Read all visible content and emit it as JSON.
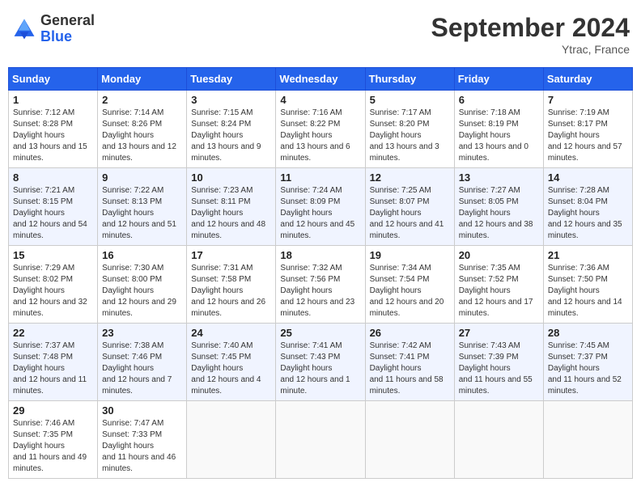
{
  "header": {
    "logo_general": "General",
    "logo_blue": "Blue",
    "month_title": "September 2024",
    "location": "Ytrac, France"
  },
  "weekdays": [
    "Sunday",
    "Monday",
    "Tuesday",
    "Wednesday",
    "Thursday",
    "Friday",
    "Saturday"
  ],
  "weeks": [
    [
      {
        "day": "1",
        "sunrise": "7:12 AM",
        "sunset": "8:28 PM",
        "daylight": "13 hours and 15 minutes."
      },
      {
        "day": "2",
        "sunrise": "7:14 AM",
        "sunset": "8:26 PM",
        "daylight": "13 hours and 12 minutes."
      },
      {
        "day": "3",
        "sunrise": "7:15 AM",
        "sunset": "8:24 PM",
        "daylight": "13 hours and 9 minutes."
      },
      {
        "day": "4",
        "sunrise": "7:16 AM",
        "sunset": "8:22 PM",
        "daylight": "13 hours and 6 minutes."
      },
      {
        "day": "5",
        "sunrise": "7:17 AM",
        "sunset": "8:20 PM",
        "daylight": "13 hours and 3 minutes."
      },
      {
        "day": "6",
        "sunrise": "7:18 AM",
        "sunset": "8:19 PM",
        "daylight": "13 hours and 0 minutes."
      },
      {
        "day": "7",
        "sunrise": "7:19 AM",
        "sunset": "8:17 PM",
        "daylight": "12 hours and 57 minutes."
      }
    ],
    [
      {
        "day": "8",
        "sunrise": "7:21 AM",
        "sunset": "8:15 PM",
        "daylight": "12 hours and 54 minutes."
      },
      {
        "day": "9",
        "sunrise": "7:22 AM",
        "sunset": "8:13 PM",
        "daylight": "12 hours and 51 minutes."
      },
      {
        "day": "10",
        "sunrise": "7:23 AM",
        "sunset": "8:11 PM",
        "daylight": "12 hours and 48 minutes."
      },
      {
        "day": "11",
        "sunrise": "7:24 AM",
        "sunset": "8:09 PM",
        "daylight": "12 hours and 45 minutes."
      },
      {
        "day": "12",
        "sunrise": "7:25 AM",
        "sunset": "8:07 PM",
        "daylight": "12 hours and 41 minutes."
      },
      {
        "day": "13",
        "sunrise": "7:27 AM",
        "sunset": "8:05 PM",
        "daylight": "12 hours and 38 minutes."
      },
      {
        "day": "14",
        "sunrise": "7:28 AM",
        "sunset": "8:04 PM",
        "daylight": "12 hours and 35 minutes."
      }
    ],
    [
      {
        "day": "15",
        "sunrise": "7:29 AM",
        "sunset": "8:02 PM",
        "daylight": "12 hours and 32 minutes."
      },
      {
        "day": "16",
        "sunrise": "7:30 AM",
        "sunset": "8:00 PM",
        "daylight": "12 hours and 29 minutes."
      },
      {
        "day": "17",
        "sunrise": "7:31 AM",
        "sunset": "7:58 PM",
        "daylight": "12 hours and 26 minutes."
      },
      {
        "day": "18",
        "sunrise": "7:32 AM",
        "sunset": "7:56 PM",
        "daylight": "12 hours and 23 minutes."
      },
      {
        "day": "19",
        "sunrise": "7:34 AM",
        "sunset": "7:54 PM",
        "daylight": "12 hours and 20 minutes."
      },
      {
        "day": "20",
        "sunrise": "7:35 AM",
        "sunset": "7:52 PM",
        "daylight": "12 hours and 17 minutes."
      },
      {
        "day": "21",
        "sunrise": "7:36 AM",
        "sunset": "7:50 PM",
        "daylight": "12 hours and 14 minutes."
      }
    ],
    [
      {
        "day": "22",
        "sunrise": "7:37 AM",
        "sunset": "7:48 PM",
        "daylight": "12 hours and 11 minutes."
      },
      {
        "day": "23",
        "sunrise": "7:38 AM",
        "sunset": "7:46 PM",
        "daylight": "12 hours and 7 minutes."
      },
      {
        "day": "24",
        "sunrise": "7:40 AM",
        "sunset": "7:45 PM",
        "daylight": "12 hours and 4 minutes."
      },
      {
        "day": "25",
        "sunrise": "7:41 AM",
        "sunset": "7:43 PM",
        "daylight": "12 hours and 1 minute."
      },
      {
        "day": "26",
        "sunrise": "7:42 AM",
        "sunset": "7:41 PM",
        "daylight": "11 hours and 58 minutes."
      },
      {
        "day": "27",
        "sunrise": "7:43 AM",
        "sunset": "7:39 PM",
        "daylight": "11 hours and 55 minutes."
      },
      {
        "day": "28",
        "sunrise": "7:45 AM",
        "sunset": "7:37 PM",
        "daylight": "11 hours and 52 minutes."
      }
    ],
    [
      {
        "day": "29",
        "sunrise": "7:46 AM",
        "sunset": "7:35 PM",
        "daylight": "11 hours and 49 minutes."
      },
      {
        "day": "30",
        "sunrise": "7:47 AM",
        "sunset": "7:33 PM",
        "daylight": "11 hours and 46 minutes."
      },
      null,
      null,
      null,
      null,
      null
    ]
  ]
}
